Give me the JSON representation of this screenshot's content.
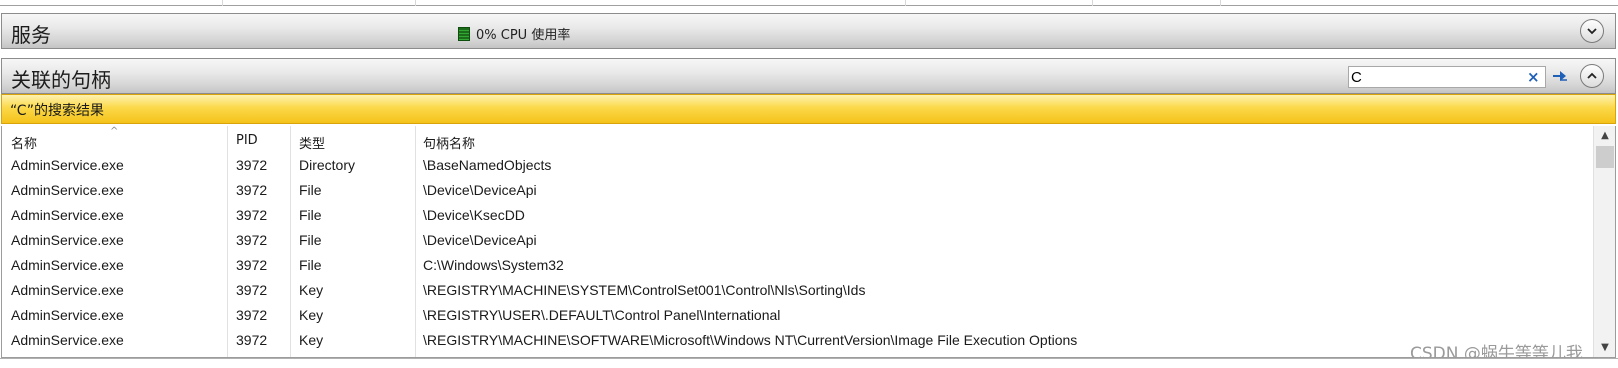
{
  "services": {
    "title": "服务",
    "cpu_label": "0% CPU 使用率"
  },
  "handles": {
    "title": "关联的句柄",
    "search": {
      "value": "C",
      "clear_icon": "×"
    }
  },
  "results": {
    "banner_text": "“C”的搜索结果"
  },
  "table": {
    "columns": [
      "名称",
      "PID",
      "类型",
      "句柄名称"
    ],
    "rows": [
      [
        "AdminService.exe",
        "3972",
        "Directory",
        "\\BaseNamedObjects"
      ],
      [
        "AdminService.exe",
        "3972",
        "File",
        "\\Device\\DeviceApi"
      ],
      [
        "AdminService.exe",
        "3972",
        "File",
        "\\Device\\KsecDD"
      ],
      [
        "AdminService.exe",
        "3972",
        "File",
        "\\Device\\DeviceApi"
      ],
      [
        "AdminService.exe",
        "3972",
        "File",
        "C:\\Windows\\System32"
      ],
      [
        "AdminService.exe",
        "3972",
        "Key",
        "\\REGISTRY\\MACHINE\\SYSTEM\\ControlSet001\\Control\\Nls\\Sorting\\Ids"
      ],
      [
        "AdminService.exe",
        "3972",
        "Key",
        "\\REGISTRY\\USER\\.DEFAULT\\Control Panel\\International"
      ],
      [
        "AdminService.exe",
        "3972",
        "Key",
        "\\REGISTRY\\MACHINE\\SOFTWARE\\Microsoft\\Windows NT\\CurrentVersion\\Image File Execution Options"
      ]
    ]
  },
  "watermark": "CSDN @蜗牛等等儿我",
  "colors": {
    "banner": "#fbd94a",
    "cpu_meter": "#1f7a1f",
    "accent": "#1e5fb8"
  }
}
